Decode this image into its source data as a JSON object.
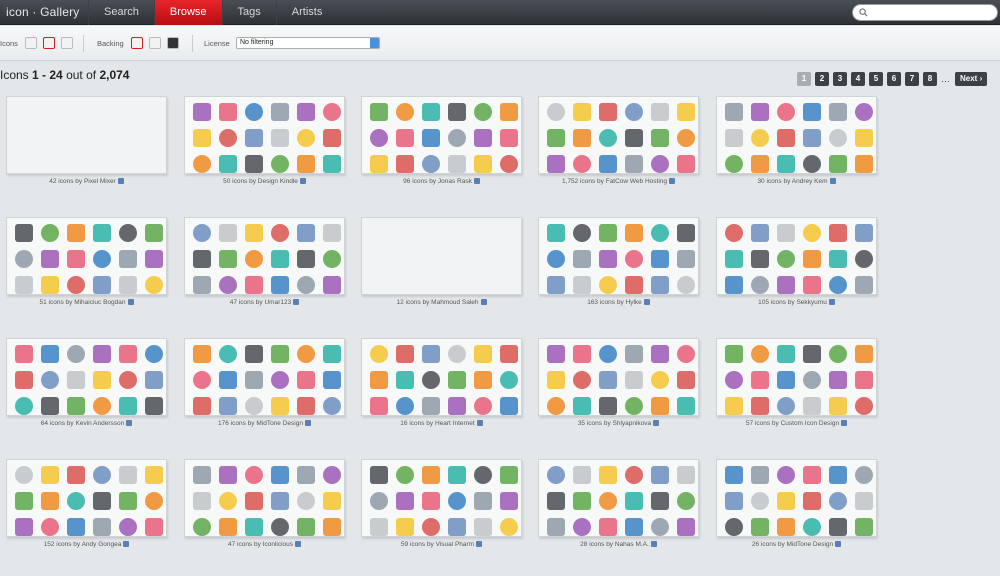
{
  "app": {
    "logo": "icon · Gallery"
  },
  "nav": [
    {
      "label": "Search",
      "active": false
    },
    {
      "label": "Browse",
      "active": true
    },
    {
      "label": "Tags",
      "active": false
    },
    {
      "label": "Artists",
      "active": false
    }
  ],
  "search": {
    "placeholder": ""
  },
  "filters": {
    "icons_label": "Icons",
    "backing_label": "Backing",
    "license_label": "License",
    "license_value": "No filtering"
  },
  "results": {
    "prefix": "Icons",
    "range": "1 - 24",
    "middle": "out of",
    "total": "2,074"
  },
  "pagination": {
    "pages": [
      "1",
      "2",
      "3",
      "4",
      "5",
      "6",
      "7",
      "8"
    ],
    "active": "1",
    "ellipsis": "…",
    "next": "Next"
  },
  "sets": [
    {
      "count": "42",
      "artist": "Pixel Mixer",
      "empty": true
    },
    {
      "count": "50",
      "artist": "Design Kindle"
    },
    {
      "count": "96",
      "artist": "Jonas Rask"
    },
    {
      "count": "1,752",
      "artist": "FatCow Web Hosting"
    },
    {
      "count": "30",
      "artist": "Andrey Kem"
    },
    {
      "count": "51",
      "artist": "Mihaiciuc Bogdan"
    },
    {
      "count": "47",
      "artist": "Umar123"
    },
    {
      "count": "12",
      "artist": "Mahmoud Saleh",
      "empty": true
    },
    {
      "count": "163",
      "artist": "Hylke"
    },
    {
      "count": "105",
      "artist": "Sekkyumu"
    },
    {
      "count": "64",
      "artist": "Kevin Andersson"
    },
    {
      "count": "176",
      "artist": "MidTone Design"
    },
    {
      "count": "16",
      "artist": "Heart Internet"
    },
    {
      "count": "35",
      "artist": "Shlyapnikova"
    },
    {
      "count": "57",
      "artist": "Custom Icon Design"
    },
    {
      "count": "152",
      "artist": "Andy Gongea"
    },
    {
      "count": "47",
      "artist": "Iconlicious"
    },
    {
      "count": "59",
      "artist": "Visual Pharm"
    },
    {
      "count": "28",
      "artist": "Nahas M.A."
    },
    {
      "count": "26",
      "artist": "MidTone Design"
    }
  ],
  "caption_mid": "icons by",
  "colors": {
    "accent": "#d21e24",
    "nav_bg": "#2e3236"
  }
}
